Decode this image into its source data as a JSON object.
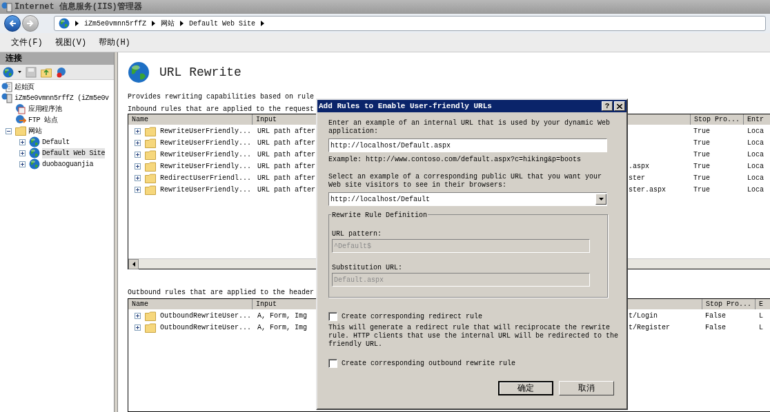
{
  "window": {
    "title": "Internet 信息服务(IIS)管理器"
  },
  "address_bar": {
    "crumbs": [
      "iZm5e0vmnn5rffZ",
      "网站",
      "Default Web Site"
    ]
  },
  "menu": [
    "文件(F)",
    "视图(V)",
    "帮助(H)"
  ],
  "connections": {
    "title": "连接",
    "tree": [
      {
        "label": "起始页",
        "kind": "start",
        "selected": false
      },
      {
        "label": "iZm5e0vmnn5rffZ (iZm5e0v",
        "kind": "server",
        "selected": false,
        "children": [
          {
            "label": "应用程序池",
            "kind": "pool",
            "selected": false
          },
          {
            "label": "FTP 站点",
            "kind": "ftp",
            "selected": false
          },
          {
            "label": "网站",
            "kind": "folder",
            "selected": false,
            "expanded": true,
            "children": [
              {
                "label": "Default",
                "kind": "site",
                "selected": false,
                "expanded": false
              },
              {
                "label": "Default Web Site",
                "kind": "site",
                "selected": true,
                "expanded": false
              },
              {
                "label": "duobaoguanjia",
                "kind": "site",
                "selected": false,
                "expanded": false
              }
            ]
          }
        ]
      }
    ]
  },
  "feature": {
    "title": "URL Rewrite",
    "description": "Provides rewriting capabilities based on rule",
    "inbound": {
      "caption": "Inbound rules that are applied to the request",
      "columns": [
        "Name",
        "Input",
        "Stop Pro...",
        "Entr"
      ],
      "rows": [
        {
          "name": "RewriteUserFriendly...",
          "input": "URL path after",
          "stop": "True",
          "entry": "Loca"
        },
        {
          "name": "RewriteUserFriendly...",
          "input": "URL path after",
          "stop": "True",
          "entry": "Loca"
        },
        {
          "name": "RewriteUserFriendly...",
          "input": "URL path after",
          "stop": "True",
          "entry": "Loca"
        },
        {
          "name": "RewriteUserFriendly...",
          "input": "URL path after",
          "column_3": ".aspx",
          "stop": "True",
          "entry": "Loca"
        },
        {
          "name": "RedirectUserFriendl...",
          "input": "URL path after",
          "column_3": "ster",
          "stop": "True",
          "entry": "Loca"
        },
        {
          "name": "RewriteUserFriendly...",
          "input": "URL path after",
          "column_3": "ster.aspx",
          "stop": "True",
          "entry": "Loca"
        }
      ]
    },
    "outbound": {
      "caption": "Outbound rules that are applied to the header",
      "columns": [
        "Name",
        "Input",
        "Stop Pro...",
        "E"
      ],
      "rows": [
        {
          "name": "OutboundRewriteUser...",
          "input": "A, Form, Img",
          "column_3": "t/Login",
          "stop": "False",
          "entry": "L"
        },
        {
          "name": "OutboundRewriteUser...",
          "input": "A, Form, Img",
          "column_3": "t/Register",
          "stop": "False",
          "entry": "L"
        }
      ]
    }
  },
  "dialog": {
    "title": "Add Rules to Enable User-friendly URLs",
    "help_button": "?",
    "internal_url": {
      "label": "Enter an example of an internal URL that is used by your dynamic Web application:",
      "value": "http://localhost/Default.aspx",
      "example": "Example: http://www.contoso.com/default.aspx?c=hiking&p=boots"
    },
    "public_url": {
      "label": "Select an example of a corresponding public URL that you want your Web site visitors to see in their browsers:",
      "value": "http://localhost/Default"
    },
    "group": {
      "title": "Rewrite Rule Definition",
      "fields": [
        {
          "label": "URL pattern:",
          "value": "^Default$",
          "disabled": true
        },
        {
          "label": "Substitution URL:",
          "value": "Default.aspx",
          "disabled": true
        }
      ]
    },
    "options": [
      {
        "label": "Create corresponding redirect rule",
        "checked": false,
        "description": "This will generate a redirect rule that will reciprocate the rewrite rule. HTTP clients that use the internal URL will be redirected to the friendly URL."
      },
      {
        "label": "Create corresponding outbound rewrite rule",
        "checked": false
      }
    ],
    "buttons": [
      {
        "label": "确定",
        "default": true
      },
      {
        "label": "取消",
        "default": false
      }
    ]
  }
}
